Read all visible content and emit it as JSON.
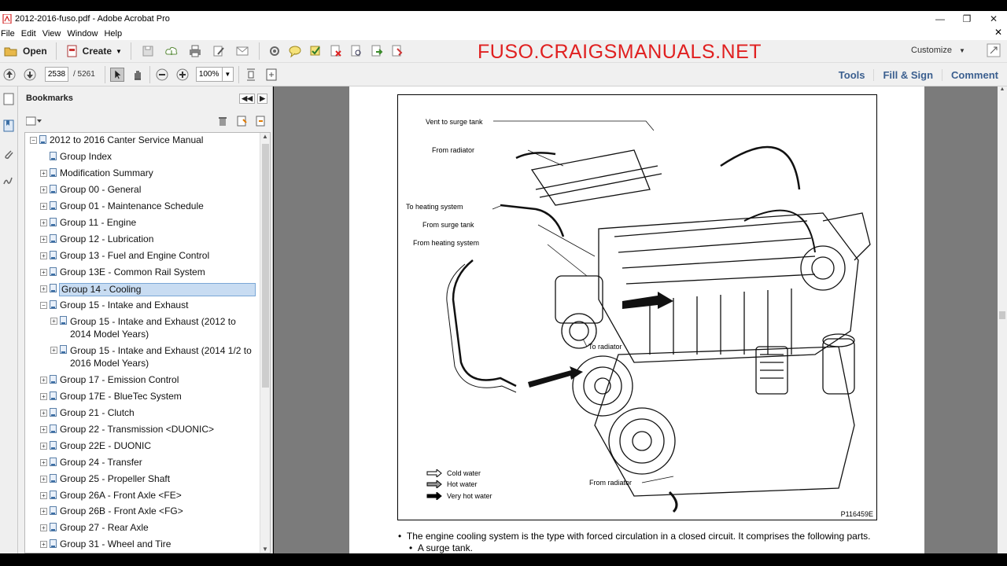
{
  "window": {
    "title": "2012-2016-fuso.pdf - Adobe Acrobat Pro"
  },
  "menu": [
    "File",
    "Edit",
    "View",
    "Window",
    "Help"
  ],
  "toolbar": {
    "open": "Open",
    "create": "Create",
    "customize": "Customize"
  },
  "brand": "FUSO.CRAIGSMANUALS.NET",
  "nav": {
    "page": "2538",
    "total": "/ 5261",
    "zoom": "100%"
  },
  "right_links": [
    "Tools",
    "Fill & Sign",
    "Comment"
  ],
  "panel": {
    "title": "Bookmarks"
  },
  "bookmarks": [
    {
      "label": "2012 to 2016 Canter Service Manual",
      "exp": "−"
    },
    {
      "label": "Group Index",
      "exp": ""
    },
    {
      "label": "Modification Summary",
      "exp": "+"
    },
    {
      "label": "Group 00 - General",
      "exp": "+"
    },
    {
      "label": "Group 01 - Maintenance Schedule",
      "exp": "+"
    },
    {
      "label": "Group 11 - Engine",
      "exp": "+"
    },
    {
      "label": "Group 12 - Lubrication",
      "exp": "+"
    },
    {
      "label": "Group 13 - Fuel and Engine Control",
      "exp": "+"
    },
    {
      "label": "Group 13E - Common Rail System",
      "exp": "+"
    },
    {
      "label": "Group 14 - Cooling",
      "exp": "+"
    },
    {
      "label": "Group 15 - Intake and Exhaust",
      "exp": "−"
    },
    {
      "label": "Group 15 - Intake and Exhaust (2012 to 2014 Model Years)",
      "exp": "+"
    },
    {
      "label": "Group 15 - Intake and Exhaust (2014 1/2 to 2016 Model Years)",
      "exp": "+"
    },
    {
      "label": "Group 17 - Emission Control",
      "exp": "+"
    },
    {
      "label": "Group 17E - BlueTec System",
      "exp": "+"
    },
    {
      "label": "Group 21 - Clutch",
      "exp": "+"
    },
    {
      "label": "Group 22 - Transmission <DUONIC>",
      "exp": "+"
    },
    {
      "label": "Group 22E - DUONIC",
      "exp": "+"
    },
    {
      "label": "Group 24 - Transfer",
      "exp": "+"
    },
    {
      "label": "Group 25 - Propeller Shaft",
      "exp": "+"
    },
    {
      "label": "Group 26A - Front Axle <FE>",
      "exp": "+"
    },
    {
      "label": "Group 26B - Front Axle <FG>",
      "exp": "+"
    },
    {
      "label": "Group 27 - Rear Axle",
      "exp": "+"
    },
    {
      "label": "Group 31 - Wheel and Tire",
      "exp": "+"
    }
  ],
  "figure": {
    "labels": {
      "vent": "Vent to surge tank",
      "from_radiator_top": "From radiator",
      "to_heating": "To heating system",
      "from_surge": "From surge tank",
      "from_heating": "From heating system",
      "to_radiator": "To radiator",
      "from_radiator_bottom": "From radiator"
    },
    "legend": [
      "Cold water",
      "Hot water",
      "Very hot water"
    ],
    "id": "P116459E"
  },
  "body_text": {
    "line1": "The engine cooling system is the type with forced circulation in a closed circuit. It comprises the following parts.",
    "line2": "A surge tank."
  }
}
